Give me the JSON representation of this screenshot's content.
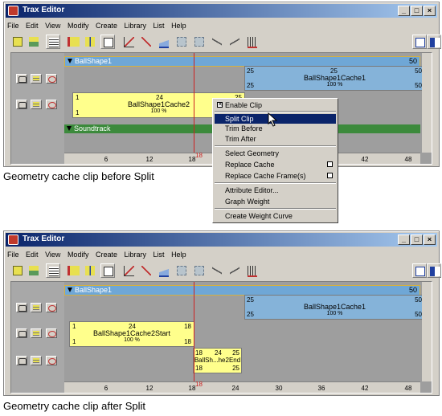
{
  "colors": {
    "title_bar": "#0a246a",
    "track_blue": "#6fa7d6",
    "clip_yellow": "#ffff8c",
    "clip_blue": "#85b3d9",
    "soundtrack_green": "#3c8a3c",
    "time_marker": "#cc2222",
    "selection": "#0a246a"
  },
  "icons": [
    "move-clip-icon",
    "scale-clip-icon",
    "outliner-icon",
    "insert-clip-icon",
    "merge-clip-icon",
    "create-pose-icon",
    "graph-editor-icon",
    "frame-all-icon",
    "frame-playback-icon",
    "trim-icon",
    "split-icon",
    "blend-icon",
    "time-warp-icon"
  ],
  "window1": {
    "title": "Trax Editor",
    "menus": [
      "File",
      "Edit",
      "View",
      "Modify",
      "Create",
      "Library",
      "List",
      "Help"
    ],
    "ballshape_label": "BallShape1",
    "ballshape_end": "50",
    "cache1": {
      "start_top": "25",
      "mid_top": "25",
      "end_top": "50",
      "name": "BallShape1Cache1",
      "percent": "100 %",
      "start_bottom": "25",
      "end_bottom": "50"
    },
    "cache2": {
      "start_top": "1",
      "mid_top": "24",
      "end_top": "25",
      "name": "BallShape1Cache2",
      "percent": "100 %",
      "start_bottom": "1",
      "end_bottom": "25"
    },
    "soundtrack_label": "Soundtrack",
    "ruler_ticks": [
      "6",
      "12",
      "18",
      "24",
      "30",
      "36",
      "42",
      "48"
    ],
    "current_time": "18",
    "context_menu": {
      "enable_clip": "Enable Clip",
      "split_clip": "Split Clip",
      "trim_before": "Trim Before",
      "trim_after": "Trim After",
      "select_geometry": "Select Geometry",
      "replace_cache": "Replace Cache",
      "replace_cache_frames": "Replace Cache Frame(s)",
      "attribute_editor": "Attribute Editor...",
      "graph_weight": "Graph Weight",
      "create_weight_curve": "Create Weight Curve"
    }
  },
  "caption1": "Geometry cache clip before Split",
  "window2": {
    "title": "Trax Editor",
    "menus": [
      "File",
      "Edit",
      "View",
      "Modify",
      "Create",
      "Library",
      "List",
      "Help"
    ],
    "ballshape_label": "BallShape1",
    "ballshape_end": "50",
    "cache1": {
      "start_top": "25",
      "end_top": "50",
      "name": "BallShape1Cache1",
      "percent": "100 %",
      "start_bottom": "25",
      "end_bottom": "50"
    },
    "cache_start": {
      "start_top": "1",
      "mid_top": "24",
      "end_top": "18",
      "name": "BallShape1Cache2Start",
      "percent": "100 %",
      "start_bottom": "1",
      "end_bottom": "18"
    },
    "cache_end": {
      "start_top": "18",
      "mid_top": "24",
      "end_top": "25",
      "name": "BallSh...he2End",
      "start_bottom": "18",
      "end_bottom": "25"
    },
    "ruler_ticks": [
      "6",
      "12",
      "18",
      "24",
      "30",
      "36",
      "42",
      "48"
    ],
    "current_time": "18"
  },
  "caption2": "Geometry cache clip after Split"
}
